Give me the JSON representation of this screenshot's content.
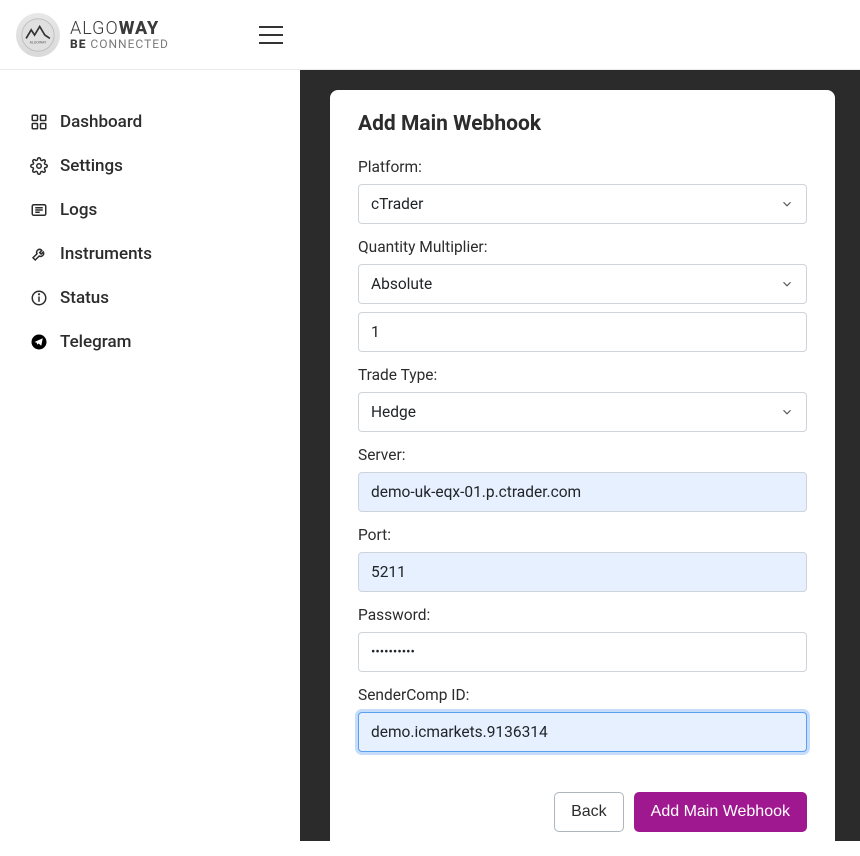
{
  "brand": {
    "text1_light": "ALGO",
    "text1_bold": "WAY",
    "text2_bold": "BE",
    "text2_light": " CONNECTED"
  },
  "sidebar": {
    "items": [
      {
        "label": "Dashboard"
      },
      {
        "label": "Settings"
      },
      {
        "label": "Logs"
      },
      {
        "label": "Instruments"
      },
      {
        "label": "Status"
      },
      {
        "label": "Telegram"
      }
    ]
  },
  "card": {
    "title": "Add Main Webhook",
    "labels": {
      "platform": "Platform:",
      "qty_multiplier": "Quantity Multiplier:",
      "trade_type": "Trade Type:",
      "server": "Server:",
      "port": "Port:",
      "password": "Password:",
      "sender_comp": "SenderComp ID:"
    },
    "values": {
      "platform": "cTrader",
      "qty_multiplier_mode": "Absolute",
      "qty_multiplier_value": "1",
      "trade_type": "Hedge",
      "server": "demo-uk-eqx-01.p.ctrader.com",
      "port": "5211",
      "password_mask": "••••••••••",
      "sender_comp": "demo.icmarkets.9136314"
    },
    "buttons": {
      "back": "Back",
      "submit": "Add Main Webhook"
    }
  }
}
